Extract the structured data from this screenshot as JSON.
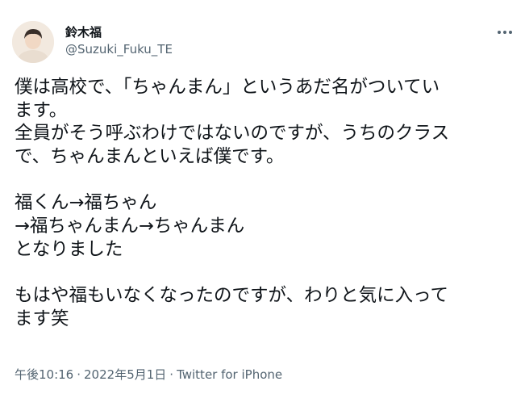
{
  "author": {
    "display_name": "鈴木福",
    "handle": "@Suzuki_Fuku_TE"
  },
  "tweet": {
    "lines": [
      "僕は高校で、「ちゃんまん」というあだ名がついてい",
      "ます。",
      "全員がそう呼ぶわけではないのですが、うちのクラス",
      "で、ちゃんまんといえば僕です。",
      "",
      "福くん→福ちゃん",
      "→福ちゃんまん→ちゃんまん",
      "となりました",
      "",
      "もはや福もいなくなったのですが、わりと気に入って",
      "ます笑"
    ]
  },
  "meta": {
    "time": "午後10:16",
    "separator": "·",
    "date": "2022年5月1日",
    "source": "Twitter for iPhone"
  },
  "icons": {
    "more": "more-horizontal-icon"
  },
  "colors": {
    "text": "#0f1419",
    "secondary": "#536471",
    "background": "#ffffff"
  }
}
